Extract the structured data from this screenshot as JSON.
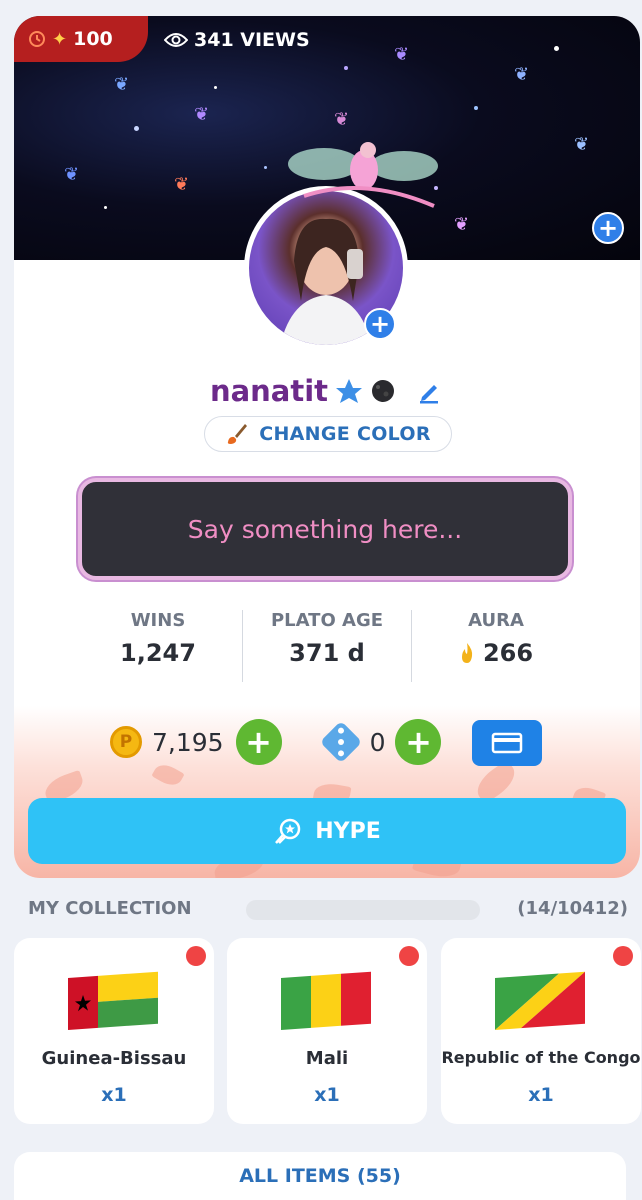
{
  "profile": {
    "streak_count": "100",
    "views": "341 VIEWS",
    "username": "nanatit",
    "change_color_label": "CHANGE COLOR",
    "bio_placeholder": "Say something here..."
  },
  "stats": [
    {
      "label": "WINS",
      "value": "1,247"
    },
    {
      "label": "PLATO AGE",
      "value": "371 d"
    },
    {
      "label": "AURA",
      "value": "266"
    }
  ],
  "currency": {
    "coin_symbol": "P",
    "coins": "7,195",
    "dice": "0"
  },
  "hype_label": "HYPE",
  "collection": {
    "title": "MY COLLECTION",
    "count": "(14/10412)",
    "items": [
      {
        "name": "Guinea-Bissau",
        "qty": "x1"
      },
      {
        "name": "Mali",
        "qty": "x1"
      },
      {
        "name": "Republic of the Congo",
        "qty": "x1"
      }
    ],
    "all_items_label": "ALL ITEMS (55)"
  },
  "colors": {
    "streak_badge": "#b51f1f",
    "username": "#6c2a8a",
    "accent_blue": "#2b6fb8",
    "hype": "#2fc2f6",
    "green": "#5fb832",
    "notification_dot": "#ef4444"
  },
  "icons": [
    "clock-icon",
    "streak-icon",
    "eye-icon",
    "plus-icon",
    "star-badge-icon",
    "pencil-icon",
    "paintbrush-icon",
    "flame-icon",
    "coin-icon",
    "dice-icon",
    "wallet-icon",
    "hype-icon"
  ]
}
